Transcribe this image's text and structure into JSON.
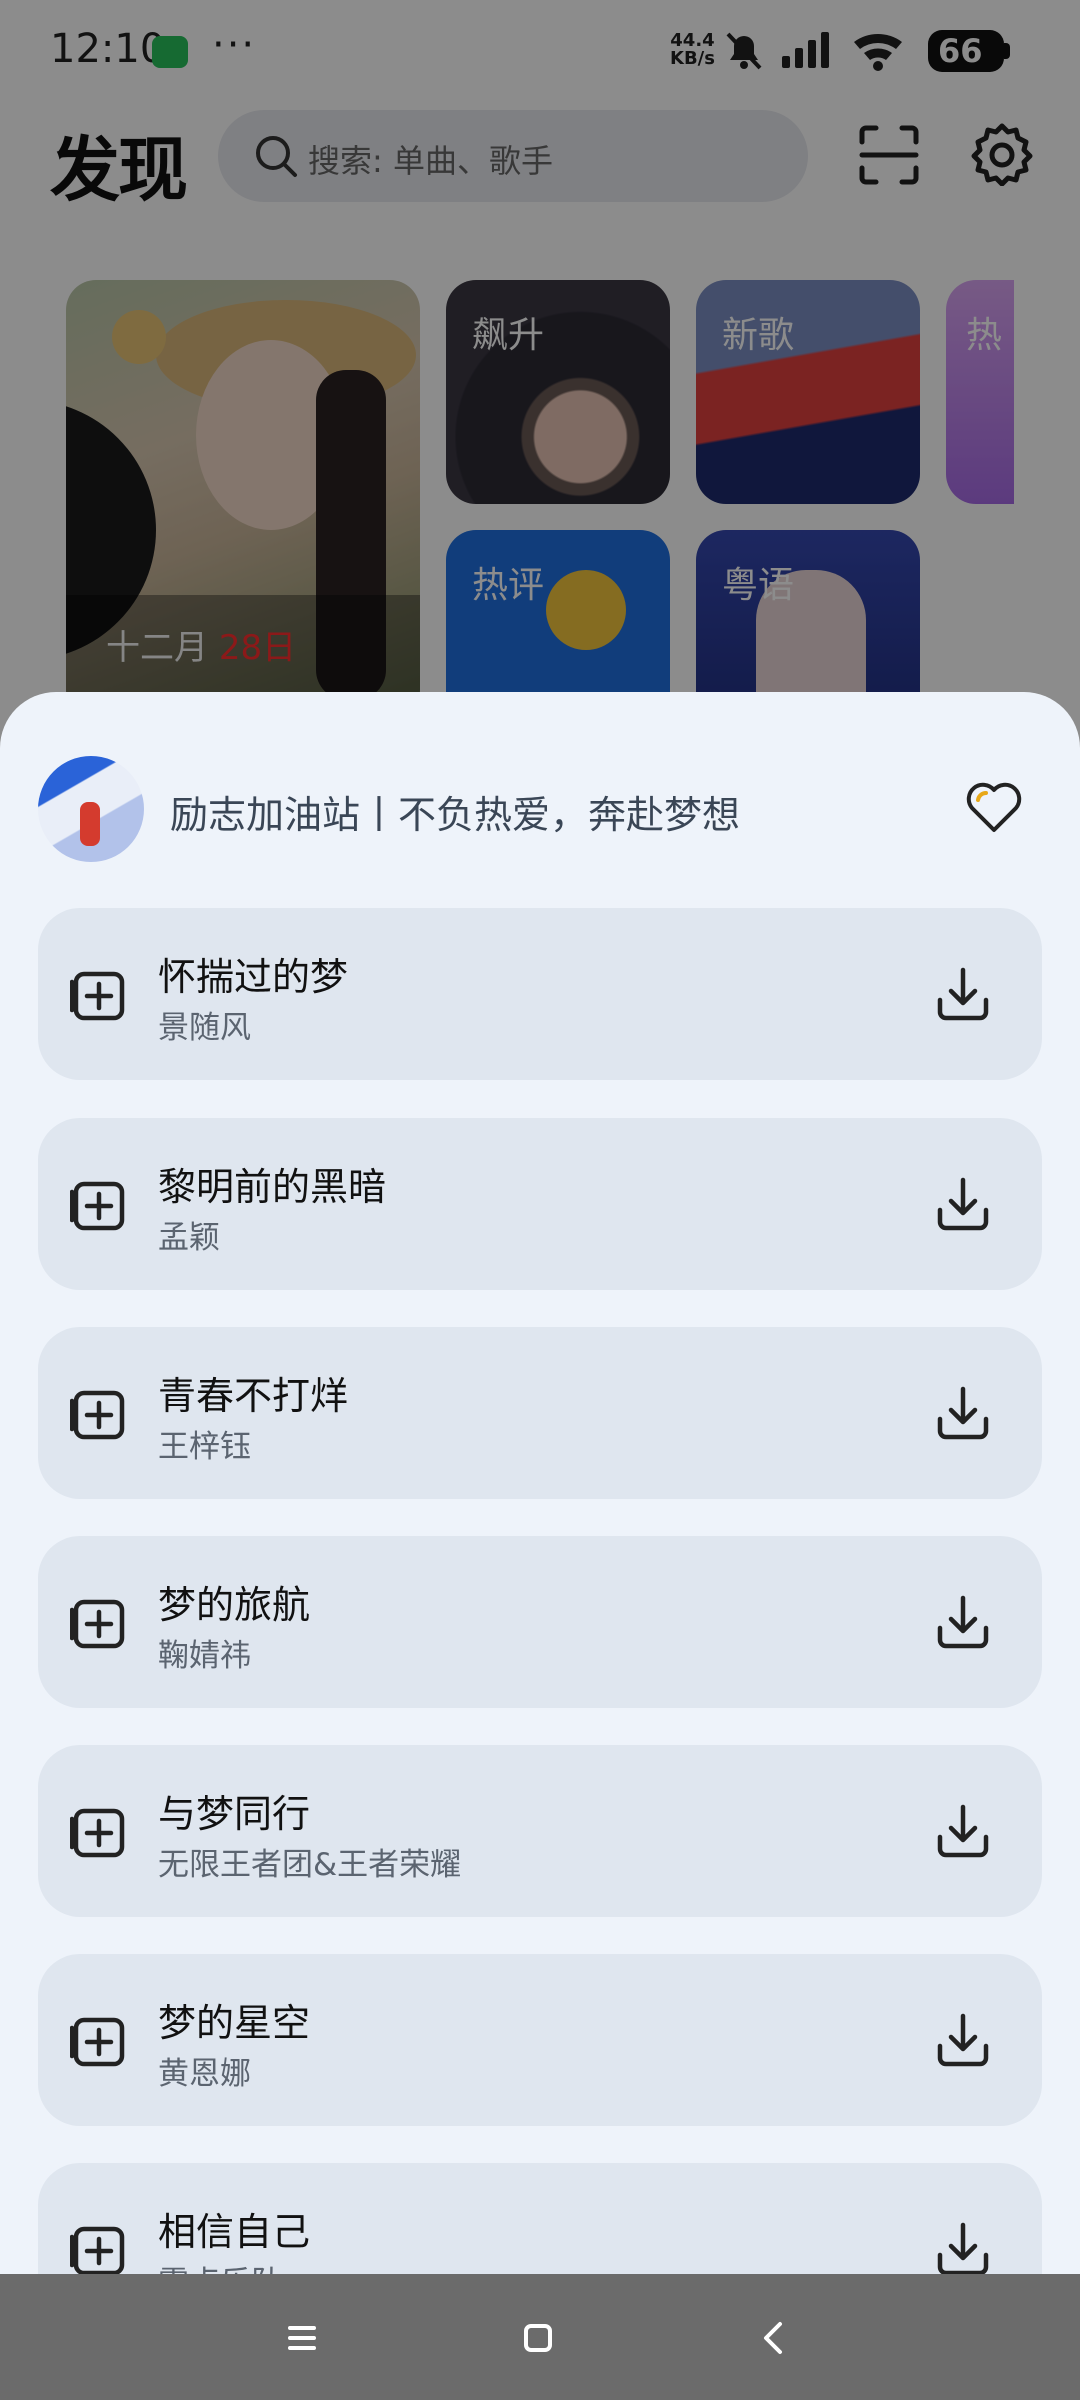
{
  "status_bar": {
    "time": "12:10",
    "more": "···",
    "net_speed_value": "44.4",
    "net_speed_unit": "KB/s",
    "battery": "66"
  },
  "header": {
    "title": "发现",
    "search_placeholder": "搜索: 单曲、歌手"
  },
  "featured": {
    "daily_card": {
      "month": "十二月",
      "day": "28日"
    },
    "categories": [
      {
        "label": "飙升"
      },
      {
        "label": "新歌"
      },
      {
        "label": "热"
      },
      {
        "label": "热评"
      },
      {
        "label": "粤语"
      }
    ]
  },
  "playlist": {
    "title": "励志加油站丨不负热爱，奔赴梦想",
    "songs": [
      {
        "title": "怀揣过的梦",
        "artist": "景随风"
      },
      {
        "title": "黎明前的黑暗",
        "artist": "孟颖"
      },
      {
        "title": "青春不打烊",
        "artist": "王梓钰"
      },
      {
        "title": "梦的旅航",
        "artist": "鞠婧祎"
      },
      {
        "title": "与梦同行",
        "artist": "无限王者团&王者荣耀"
      },
      {
        "title": "梦的星空",
        "artist": "黄恩娜"
      },
      {
        "title": "相信自己",
        "artist": "零点乐队"
      }
    ]
  },
  "colors": {
    "sheet_background": "#eef3fa",
    "song_item_background": "#dfe6ef",
    "accent_red": "#ff2f2f",
    "heart_highlight": "#e8a817"
  }
}
